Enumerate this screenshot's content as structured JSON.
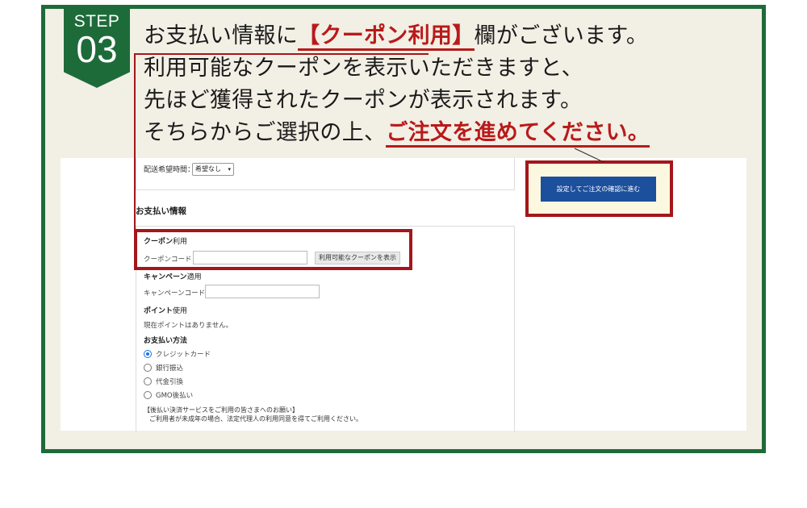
{
  "badge": {
    "step": "STEP",
    "number": "03"
  },
  "headline": {
    "line1_pre": "お支払い情報に",
    "line1_highlight": "【クーポン利用】",
    "line1_post": "欄がございます。",
    "line2": "利用可能なクーポンを表示いただきますと、",
    "line3": "先ほど獲得されたクーポンが表示されます。",
    "line4_pre": "そちらからご選択の上、",
    "line4_highlight": "ご注文を進めてください。"
  },
  "screenshot": {
    "delivery_time_label": "配送希望時間：",
    "delivery_time_value": "希望なし",
    "payment_section_title": "お支払い情報",
    "coupon": {
      "title_bold": "クーポン",
      "title_rest": "利用",
      "code_label": "クーポンコード：",
      "show_button": "利用可能なクーポンを表示"
    },
    "campaign": {
      "title_bold": "キャンペーン",
      "title_rest": "適用",
      "code_label": "キャンペーンコード："
    },
    "points": {
      "title_bold": "ポイント",
      "title_rest": "使用",
      "status": "現在ポイントはありません。"
    },
    "payment_method": {
      "title": "お支払い方法",
      "options": [
        "クレジットカード",
        "銀行振込",
        "代金引換",
        "GMO後払い"
      ],
      "selected": "クレジットカード"
    },
    "notice_line1": "【後払い決済サービスをご利用の皆さまへのお願い】",
    "notice_line2": "ご利用者が未成年の場合、法定代理人の利用同意を得てご利用ください。",
    "confirm_button": "設定してご注文の確認に進む"
  },
  "colors": {
    "brand_green": "#1e6b3a",
    "highlight_red": "#b91a1a",
    "confirm_blue": "#1c4f9c"
  }
}
